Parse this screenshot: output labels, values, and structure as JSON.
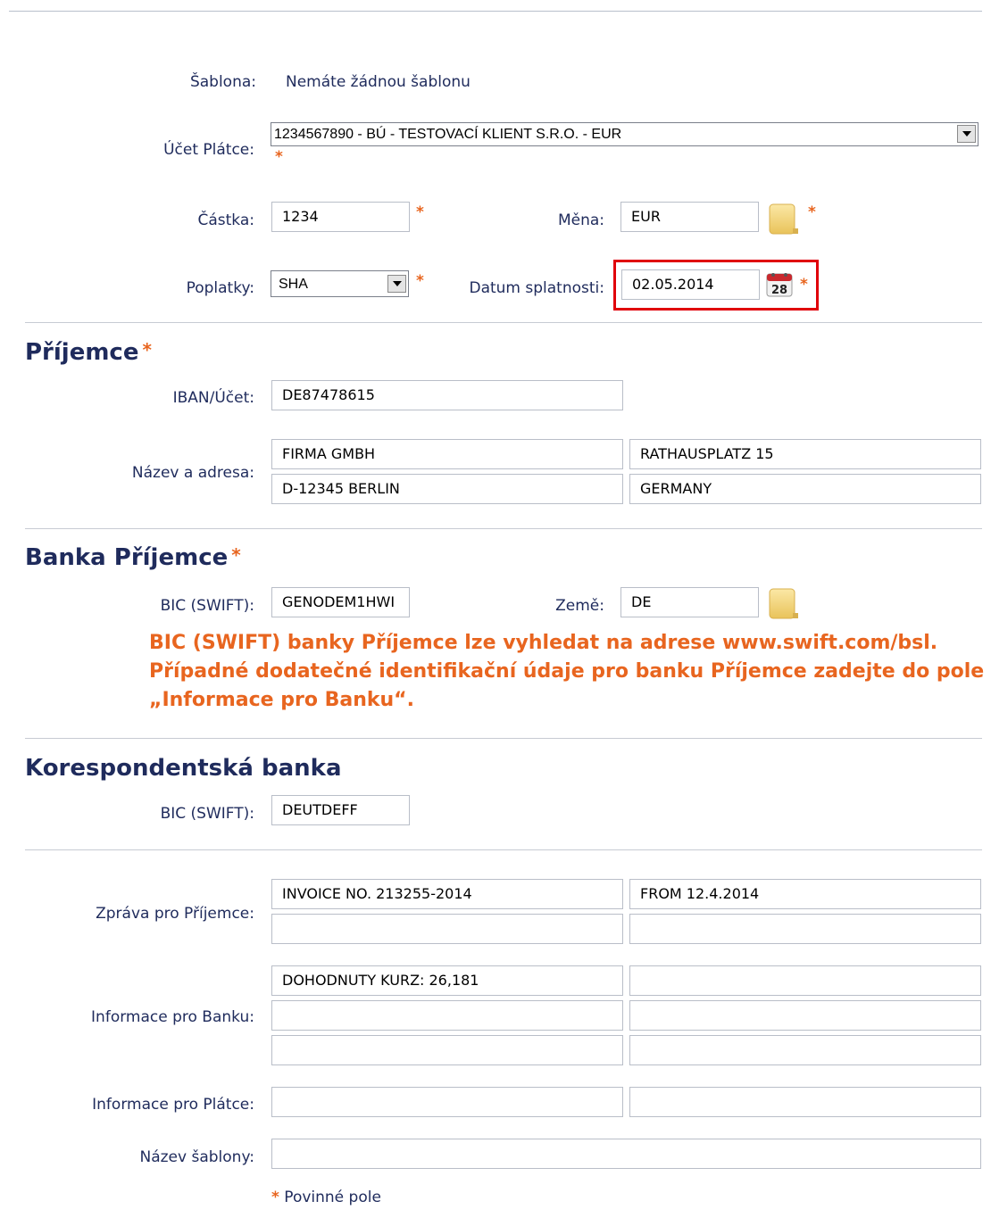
{
  "form": {
    "template_label": "Šablona:",
    "template_value": "Nemáte žádnou šablonu",
    "payer_account_label": "Účet Plátce:",
    "payer_account_value": "1234567890 - BÚ - TESTOVACÍ KLIENT S.R.O. - EUR",
    "amount_label": "Částka:",
    "amount_value": "1234",
    "currency_label": "Měna:",
    "currency_value": "EUR",
    "fees_label": "Poplatky:",
    "fees_value": "SHA",
    "due_date_label": "Datum splatnosti:",
    "due_date_value": "02.05.2014",
    "calendar_day": "28",
    "required_mark": "*"
  },
  "recipient": {
    "heading": "Příjemce",
    "iban_label": "IBAN/Účet:",
    "iban_value": "DE87478615",
    "name_address_label": "Název a adresa:",
    "name_line1": "FIRMA GMBH",
    "address_line1": "RATHAUSPLATZ 15",
    "name_line2": "D-12345 BERLIN",
    "address_line2": "GERMANY"
  },
  "recipient_bank": {
    "heading": "Banka Příjemce",
    "bic_label": "BIC (SWIFT):",
    "bic_value": "GENODEM1HWI",
    "country_label": "Země:",
    "country_value": "DE",
    "note_line1": "BIC (SWIFT) banky Příjemce lze vyhledat na adrese www.swift.com/bsl.",
    "note_line2": "Případné dodatečné identifikační údaje pro banku Příjemce zadejte do pole",
    "note_line3": "„Informace pro Banku“."
  },
  "correspondent_bank": {
    "heading": "Korespondentská banka",
    "bic_label": "BIC (SWIFT):",
    "bic_value": "DEUTDEFF"
  },
  "messages": {
    "recipient_msg_label": "Zpráva pro Příjemce:",
    "recipient_msg_1a": "INVOICE NO. 213255-2014",
    "recipient_msg_1b": "FROM 12.4.2014",
    "recipient_msg_2a": "",
    "recipient_msg_2b": "",
    "bank_info_label": "Informace pro Banku:",
    "bank_info_1a": "DOHODNUTY KURZ: 26,181",
    "bank_info_1b": "",
    "bank_info_2a": "",
    "bank_info_2b": "",
    "bank_info_3a": "",
    "bank_info_3b": "",
    "payer_info_label": "Informace pro Plátce:",
    "payer_info_a": "",
    "payer_info_b": "",
    "template_name_label": "Název šablony:",
    "template_name_value": "",
    "required_note": "Povinné pole"
  },
  "colors": {
    "label": "#1f2b5c",
    "required": "#e8651f",
    "highlight": "#e0000a"
  }
}
